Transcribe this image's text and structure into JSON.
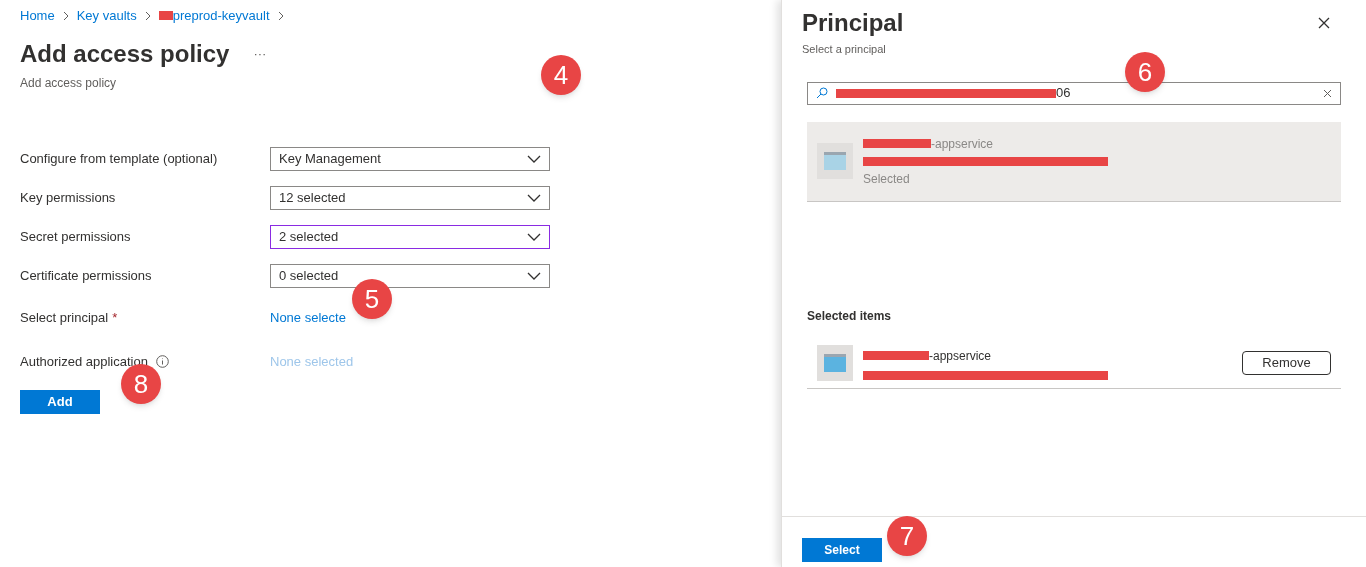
{
  "breadcrumb": [
    {
      "label": "Home",
      "redacted": false
    },
    {
      "label": "Key vaults",
      "redacted": false
    },
    {
      "label": "preprod-keyvault",
      "redacted": true
    }
  ],
  "page": {
    "title": "Add access policy",
    "more": "···",
    "subtitle": "Add access policy"
  },
  "form": {
    "rows": [
      {
        "kind": "dropdown",
        "label": "Configure from template (optional)",
        "value": "Key Management",
        "focused": false
      },
      {
        "kind": "dropdown",
        "label": "Key permissions",
        "value": "12 selected",
        "focused": false
      },
      {
        "kind": "dropdown",
        "label": "Secret permissions",
        "value": "2 selected",
        "focused": true
      },
      {
        "kind": "dropdown",
        "label": "Certificate permissions",
        "value": "0 selected",
        "focused": false
      },
      {
        "kind": "link",
        "label": "Select principal",
        "required": true,
        "info": false,
        "value": "None selecte",
        "disabled": false
      },
      {
        "kind": "link",
        "label": "Authorized application",
        "required": false,
        "info": true,
        "value": "None selected",
        "disabled": true
      }
    ],
    "add_button": "Add",
    "required_mark": "*"
  },
  "panel": {
    "title": "Principal",
    "subtitle": "Select a principal",
    "search": {
      "value": "06"
    },
    "results": [
      {
        "name": "-appservice",
        "status": "Selected",
        "selected": true
      }
    ],
    "selected_heading": "Selected items",
    "selected_items": [
      {
        "name": "-appservice",
        "remove": "Remove"
      }
    ],
    "select_button": "Select"
  },
  "annotations": [
    "4",
    "5",
    "6",
    "7",
    "8"
  ]
}
